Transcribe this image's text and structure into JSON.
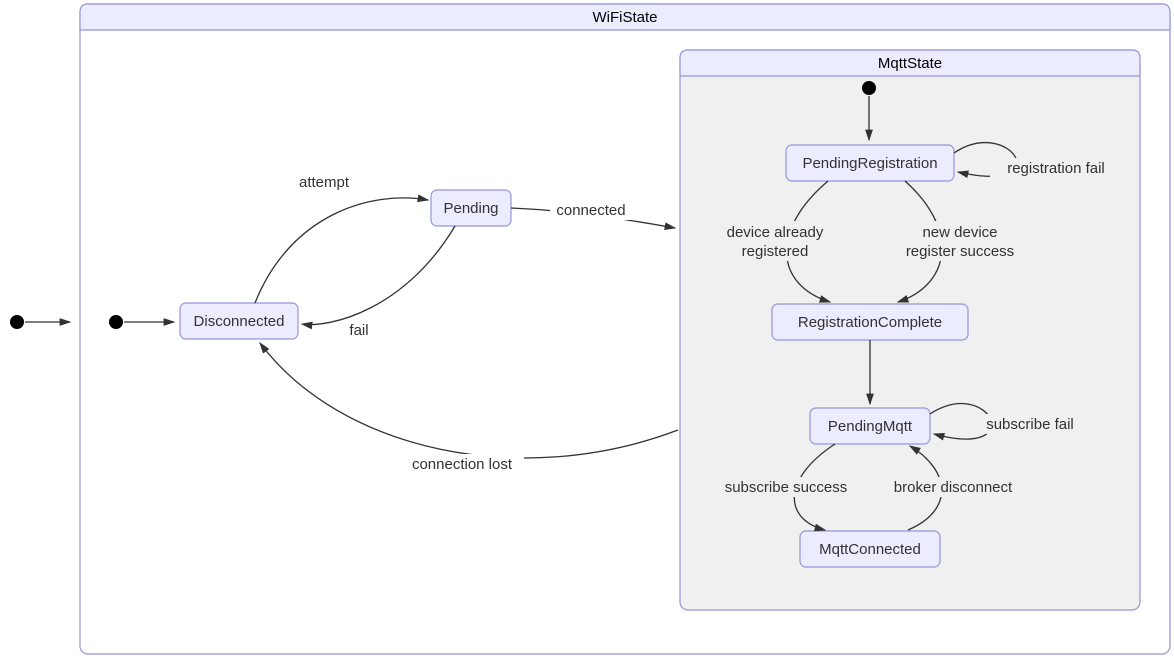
{
  "diagram": {
    "outer": {
      "title": "WiFiState"
    },
    "inner": {
      "title": "MqttState"
    },
    "states": {
      "disconnected": "Disconnected",
      "pending": "Pending",
      "pendingRegistration": "PendingRegistration",
      "registrationComplete": "RegistrationComplete",
      "pendingMqtt": "PendingMqtt",
      "mqttConnected": "MqttConnected"
    },
    "transitions": {
      "attempt": "attempt",
      "fail": "fail",
      "connected": "connected",
      "connectionLost": "connection lost",
      "registrationFail": "registration fail",
      "deviceAlreadyL1": "device already",
      "deviceAlreadyL2": "registered",
      "newDeviceL1": "new device",
      "newDeviceL2": "register success",
      "subscribeFail": "subscribe fail",
      "subscribeSuccess": "subscribe success",
      "brokerDisconnect": "broker disconnect"
    }
  }
}
